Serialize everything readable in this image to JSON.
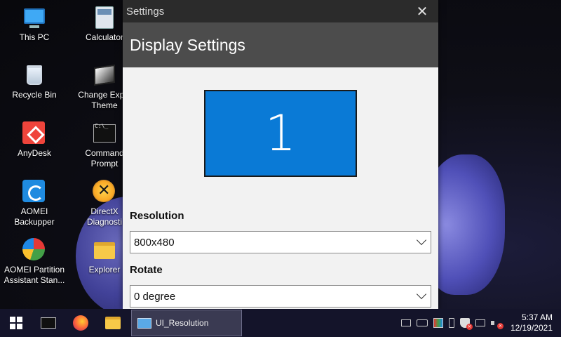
{
  "desktop": {
    "icons": [
      {
        "label": "This PC",
        "icon": "monitor-icon"
      },
      {
        "label": "Recycle Bin",
        "icon": "recycle-bin-icon"
      },
      {
        "label": "AnyDesk",
        "icon": "anydesk-icon"
      },
      {
        "label": "AOMEI Backupper",
        "icon": "aomei-backupper-icon"
      },
      {
        "label": "AOMEI Partition\nAssistant Stan...",
        "icon": "aomei-partition-icon"
      },
      {
        "label": "Calculator",
        "icon": "calculator-icon"
      },
      {
        "label": "Change Explo\nTheme",
        "icon": "theme-icon"
      },
      {
        "label": "Command\nPrompt",
        "icon": "command-prompt-icon"
      },
      {
        "label": "DirectX\nDiagnosti",
        "icon": "directx-icon"
      },
      {
        "label": "Explorer",
        "icon": "folder-icon"
      }
    ]
  },
  "window": {
    "title": "Settings",
    "close_glyph": "✕",
    "header": "Display Settings",
    "monitor_number": "1",
    "resolution_label": "Resolution",
    "resolution_value": "800x480",
    "rotate_label": "Rotate",
    "rotate_value": "0 degree"
  },
  "taskbar": {
    "app_label": "UI_Resolution",
    "time": "5:37 AM",
    "date": "12/19/2021",
    "tray_icons": [
      "network-icon",
      "keyboard-icon",
      "color-icon",
      "usb-icon",
      "security-icon",
      "pc-icon",
      "volume-muted-icon"
    ]
  },
  "colors": {
    "accent_monitor": "#0a7ad6",
    "titlebar": "#2b2b2b",
    "header_band": "#4c4c4c",
    "taskbar": "#14142a"
  }
}
